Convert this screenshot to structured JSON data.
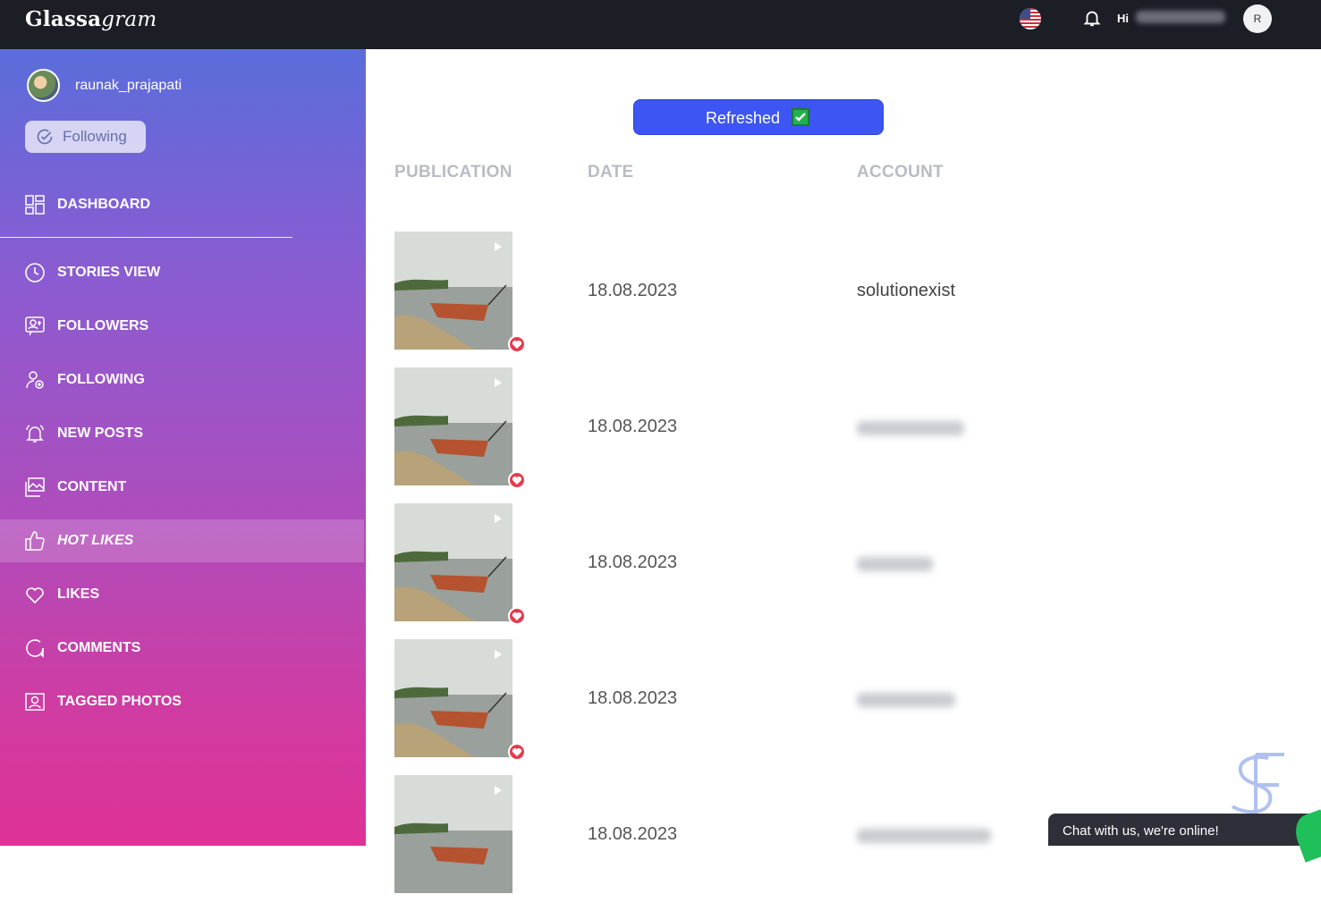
{
  "header": {
    "brand_part1": "Glassa",
    "brand_part2": "gram",
    "greeting": "Hi",
    "avatar_initial": "R",
    "flag_icon": "us-flag-icon",
    "bell_icon": "bell-icon"
  },
  "sidebar": {
    "username": "raunak_prajapati",
    "follow_label": "Following",
    "items": [
      {
        "label": "DASHBOARD",
        "icon": "dashboard-icon"
      },
      {
        "label": "STORIES VIEW",
        "icon": "clock-icon"
      },
      {
        "label": "FOLLOWERS",
        "icon": "followers-icon"
      },
      {
        "label": "FOLLOWING",
        "icon": "following-icon"
      },
      {
        "label": "NEW POSTS",
        "icon": "bell-icon"
      },
      {
        "label": "CONTENT",
        "icon": "image-icon"
      },
      {
        "label": "HOT LIKES",
        "icon": "thumbs-up-icon",
        "active": true
      },
      {
        "label": "LIKES",
        "icon": "heart-icon"
      },
      {
        "label": "COMMENTS",
        "icon": "comment-icon"
      },
      {
        "label": "TAGGED PHOTOS",
        "icon": "tagged-photo-icon"
      }
    ]
  },
  "main": {
    "refresh_label": "Refreshed",
    "columns": {
      "publication": "PUBLICATION",
      "date": "DATE",
      "account": "ACCOUNT"
    },
    "rows": [
      {
        "date": "18.08.2023",
        "account": "solutionexist"
      },
      {
        "date": "18.08.2023",
        "account": ""
      },
      {
        "date": "18.08.2023",
        "account": ""
      },
      {
        "date": "18.08.2023",
        "account": ""
      },
      {
        "date": "18.08.2023",
        "account": ""
      }
    ]
  },
  "chat": {
    "label": "Chat with us, we're online!"
  },
  "colors": {
    "accent": "#3d55f2",
    "topbar": "#1c1e26",
    "heart": "#e73a4e"
  }
}
